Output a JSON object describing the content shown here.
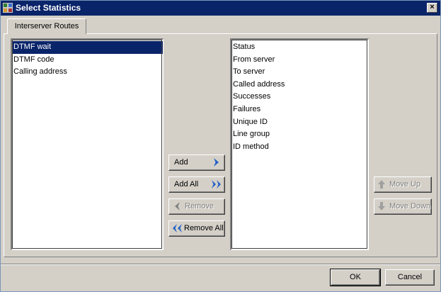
{
  "window": {
    "title": "Select Statistics",
    "close_glyph": "×"
  },
  "tabs": [
    {
      "label": "Interserver Routes"
    }
  ],
  "available": {
    "items": [
      {
        "label": "DTMF wait",
        "selected": true
      },
      {
        "label": "DTMF code"
      },
      {
        "label": "Calling address"
      }
    ]
  },
  "selected": {
    "items": [
      {
        "label": "Status"
      },
      {
        "label": "From server"
      },
      {
        "label": "To server"
      },
      {
        "label": "Called address"
      },
      {
        "label": "Successes"
      },
      {
        "label": "Failures"
      },
      {
        "label": "Unique ID"
      },
      {
        "label": "Line group"
      },
      {
        "label": "ID method"
      }
    ]
  },
  "transfer": {
    "add": "Add",
    "add_all": "Add All",
    "remove": "Remove",
    "remove_all": "Remove All"
  },
  "order": {
    "move_up": "Move Up",
    "move_down": "Move Down"
  },
  "footer": {
    "ok": "OK",
    "cancel": "Cancel"
  },
  "colors": {
    "titlebar": "#0a246a",
    "selection": "#0a246a",
    "arrow_blue": "#1f5fc7",
    "face": "#d4d0c8"
  }
}
